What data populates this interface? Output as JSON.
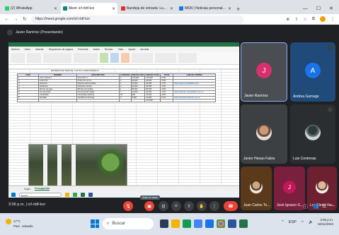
{
  "browser": {
    "tabs": [
      {
        "label": "(2) WhatsApp",
        "color": "#25d366",
        "active": false
      },
      {
        "label": "Meet: icf-rbtf-kor",
        "color": "#00897b",
        "active": true
      },
      {
        "label": "Bandeja de entrada: Luz Elena Va...",
        "color": "#d93025",
        "active": false
      },
      {
        "label": "MSN | Noticias personalizadas, vi...",
        "color": "#1a73e8",
        "active": false
      }
    ],
    "new_tab": "+",
    "url": "https://meet.google.com/icf-rbtf-kor"
  },
  "meet": {
    "presenter_label": "Javier Ramírez (Presentando)",
    "meeting_code_time": "3:06 p.m.  |  icf-rbtf-kor",
    "tooltip": "Subir la mano",
    "participants": [
      {
        "name": "Javier Ramírez",
        "initial": "J",
        "color": "#d8306e",
        "kind": "letter",
        "bg": "#4a4d52"
      },
      {
        "name": "Andrea Gamage",
        "initial": "A",
        "color": "#1a73e8",
        "kind": "letter",
        "bg": "#1f4a7a"
      },
      {
        "name": "Junior Henao Fabra",
        "initial": "",
        "color": "#8d6e63",
        "kind": "photo",
        "bg": "#3c4043"
      },
      {
        "name": "Luis Contreras",
        "initial": "",
        "color": "#5f6368",
        "kind": "photo",
        "bg": "#2b2e31"
      },
      {
        "name": "Juan Carlos To...",
        "initial": "",
        "color": "#a1887f",
        "kind": "photo",
        "bg": "#5a3a1a"
      },
      {
        "name": "José Ignacio G...",
        "initial": "J",
        "color": "#c2185b",
        "kind": "letter",
        "bg": "#7a1f3d"
      },
      {
        "name": "Luz Elena Ver...",
        "initial": "",
        "color": "#bcaaa4",
        "kind": "photo",
        "bg": "#6d2030"
      }
    ]
  },
  "sheet": {
    "menu": [
      "Archivo",
      "Inicio",
      "Insertar",
      "Disposición de página",
      "Fórmulas",
      "Datos",
      "Revisar",
      "Vista",
      "Ayuda",
      "Acrobat"
    ],
    "heading": "MATERIALES PARA EL CULTIVO HIDROPÓNICO",
    "columns": [
      "ITEM",
      "NOMBRE",
      "DESCRIPCIÓN",
      "CANTIDAD",
      "PRECIO UNIT",
      "PRECIO TOTAL",
      "TOTAL",
      "LINK DE COMPRA"
    ],
    "rows": [
      [
        "1",
        "Torre vertical 1",
        "Torre PVC 1",
        "1",
        "175.000",
        "175.000",
        "6,0%",
        ""
      ],
      [
        "2",
        "Tubo PVC",
        "Tubo PVC 4x3 m",
        "2",
        "48.000",
        "96.000",
        "3,3%",
        ""
      ],
      [
        "3",
        "Espumas",
        "Espuma para semillas",
        "1",
        "20.000",
        "20.000",
        "0,7%",
        "https://www.mercadolibre.com"
      ],
      [
        "4",
        "Nutrientes",
        "Solución nutritiva",
        "1",
        "30.000",
        "30.000",
        "1,0%",
        ""
      ],
      [
        "5",
        "Bomba de agua",
        "Bomba sumergible",
        "1",
        "85.000",
        "85.000",
        "2,9%",
        ""
      ],
      [
        "6",
        "Temporizador",
        "Temporizador digital",
        "1",
        "40.000",
        "40.000",
        "1,4%",
        "https://articulo.mercadolibre.com.co"
      ],
      [
        "7",
        "Canastillas",
        "Canastillas plásticas",
        "20",
        "800",
        "16.000",
        "0,5%",
        ""
      ],
      [
        "8",
        "Semillas",
        "Semillas de lechuga",
        "2",
        "6.000",
        "12.000",
        "0,4%",
        "https://www.homecenter.com.co"
      ]
    ],
    "total_row": [
      "",
      "",
      "",
      "",
      "",
      "474.000",
      "",
      ""
    ],
    "tabs": [
      "Hoja1",
      "Presupuesto"
    ],
    "mini_taskbar_search": "Buscar"
  },
  "taskbar": {
    "weather_temp": "17°C",
    "weather_desc": "Parc. soleado",
    "search_placeholder": "Buscar",
    "time": "3:06 p.m.",
    "date": "18/11/2023"
  }
}
